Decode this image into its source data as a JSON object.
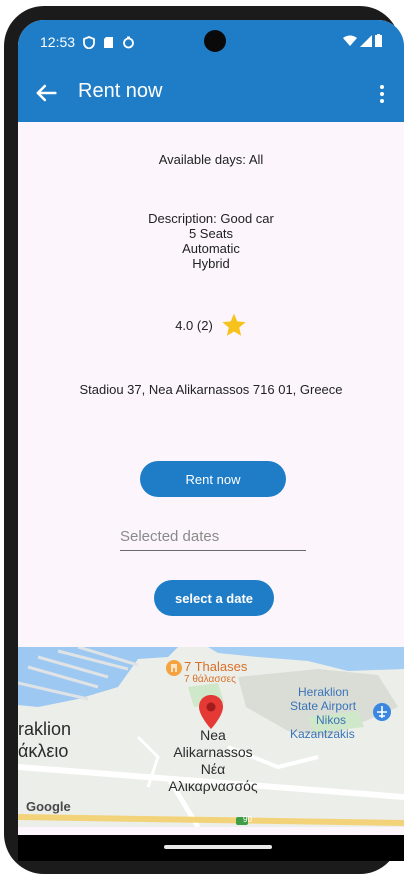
{
  "status_bar": {
    "time": "12:53"
  },
  "app_bar": {
    "title": "Rent now"
  },
  "listing": {
    "available_days": "Available days: All",
    "description_lines": [
      "Description: Good car",
      "5 Seats",
      "Automatic",
      "Hybrid"
    ],
    "rating": "4.0 (2)",
    "address": "Stadiou 37, Nea Alikarnassos 716 01, Greece"
  },
  "actions": {
    "rent_label": "Rent now",
    "dates_placeholder": "Selected dates",
    "select_date_label": "select a date"
  },
  "map": {
    "place_name": "7 Thalases",
    "place_name_local": "7 θάλασσες",
    "city_left_1": "raklion",
    "city_left_2": "άκλειο",
    "pin_label_1": "Nea",
    "pin_label_2": "Alikarnassos",
    "pin_label_3": "Νέα",
    "pin_label_4": "Αλικαρνασσός",
    "airport_1": "Heraklion",
    "airport_2": "State Airport",
    "airport_3": "Nikos",
    "airport_4": "Kazantzakis",
    "road_number": "90",
    "google_logo": "Google"
  },
  "colors": {
    "primary": "#1f7dc8",
    "star": "#f7c21b",
    "pin": "#e53935",
    "background": "#fcf6fc"
  },
  "icons": [
    "back-arrow-icon",
    "overflow-menu-icon",
    "star-icon",
    "map-pin-icon",
    "airport-icon",
    "restaurant-icon"
  ]
}
